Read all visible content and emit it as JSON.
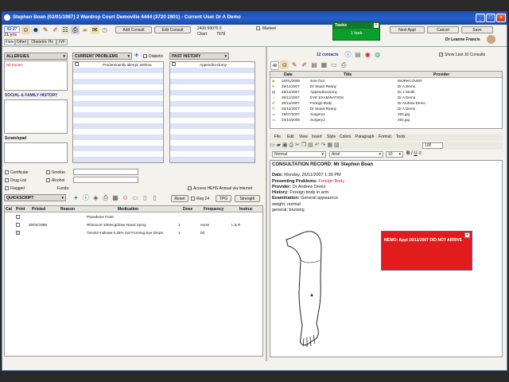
{
  "window": {
    "title": "Stephen Boan (02/01/1987) 2 Wardrop Court Demoville 4444 (3720 2801) - Current User Dr A Demo"
  },
  "patient": {
    "time": "02:27",
    "age": "21 yrs",
    "phone": "2430 59070 3",
    "chart_label": "Chart",
    "chart_no": "7978",
    "marked": "Marked"
  },
  "toolbar": {
    "add_consult": "Add Consult",
    "edit_consult": "Edit Consult",
    "next_appt": "Next Appt",
    "cancel": "Cancel",
    "save": "Save",
    "doctor": "Dr Leanne Francis"
  },
  "tasks": {
    "title": "Tasks",
    "count": "1 task"
  },
  "tabs": [
    "Flats",
    "Other",
    "Obstetric Hx",
    "IVF"
  ],
  "left": {
    "allergies": "ALLERGIES",
    "allergy_item": "Nil Known",
    "current_problems": "CURRENT PROBLEMS",
    "diabetic": "Diabetic",
    "problem_item": "Predominantly allergic asthma",
    "past_history": "PAST HISTORY",
    "past_item": "Appendicectomy",
    "social": "SOCIAL & FAMILY HISTORY",
    "scratchpad": "Scratchpad",
    "certificate": "Certificate",
    "smoker": "Smoker",
    "drug_list": "Drug List",
    "alcohol": "Alcohol",
    "flagged": "Flagged",
    "funds": "Funds:",
    "access_hehs": "Access HEHS Annual via Internet",
    "quickscript": "QUICKSCRIPT",
    "reset": "Reset",
    "reg24": "Reg 24",
    "tpg": "TPG",
    "strength": "Strength"
  },
  "meds": {
    "headers": [
      "Cat",
      "Print",
      "Printed",
      "Reason",
      "Medication",
      "Dose",
      "Frequency",
      "Instruc"
    ],
    "rows": [
      {
        "printed": "",
        "medication": "Panadeine Forte",
        "dose": "",
        "frequency": "",
        "instr": ""
      },
      {
        "printed": "26/04/1998",
        "medication": "Rhinocort 100mcg/dose Nasal Spray",
        "dose": "1",
        "frequency": "nocte",
        "instr": "L & R"
      },
      {
        "printed": "",
        "medication": "Timolol maleate 0.25% Gel Forming Eye Drops",
        "dose": "1",
        "frequency": "bd",
        "instr": ""
      }
    ]
  },
  "right": {
    "contacts": "12 contacts",
    "show_last": "Show Last 10 Consults",
    "list_headers": [
      "Date",
      "Title",
      "Provider"
    ],
    "list_rows": [
      {
        "date": "10/01/2008",
        "title": "sore foot",
        "provider": "WORKCOVER"
      },
      {
        "date": "29/11/2007",
        "title": "Dr Stuart Reany",
        "provider": "Dr A Demo"
      },
      {
        "date": "29/11/2007",
        "title": "Appendicectomy",
        "provider": "Dr J Smith"
      },
      {
        "date": "29/11/2007",
        "title": "EYE EXAMINATION",
        "provider": "Dr A Demo"
      },
      {
        "date": "26/11/2007",
        "title": "Foreign Body",
        "provider": "Dr Andrew Demo"
      },
      {
        "date": "26/11/2007",
        "title": "Dr Stuart Reany",
        "provider": "Dr A Demo"
      },
      {
        "date": "19/07/2007",
        "title": "Surgery2",
        "provider": "292.jpg"
      },
      {
        "date": "24/10/2005",
        "title": "Surgery2",
        "provider": "291.jpg"
      }
    ],
    "menu": [
      "File",
      "Edit",
      "View",
      "Insert",
      "Style",
      "Colors",
      "Paragraph",
      "Format",
      "Tools"
    ],
    "style_value": "Normal",
    "font_value": "Arial",
    "size_value": "10",
    "zoom_value": "100"
  },
  "consult": {
    "heading": "CONSULTATION RECORD: Mr Stephen Boan",
    "date_label": "Date:",
    "date_value": "Monday, 26/11/2007 1:39 PM",
    "problem_label": "Presenting Problems:",
    "problem_value": "Foreign Body",
    "provider_label": "Provider:",
    "provider_value": "Dr Andrew Demo",
    "history_label": "History:",
    "history_value": "Foreign body in arm",
    "exam_label": "Examination:",
    "exam_value": "General appearnce",
    "line1": "weight: normal",
    "line2": "general: bruising"
  },
  "memo": {
    "text": "MEMO: Appt 26/11/2007 DID NOT ARRIVE"
  },
  "colors": {
    "titlebar": "#2860cf",
    "task_green": "#0a9e2a",
    "memo_red": "#e21c1c",
    "alert_red": "#d31a1a"
  }
}
